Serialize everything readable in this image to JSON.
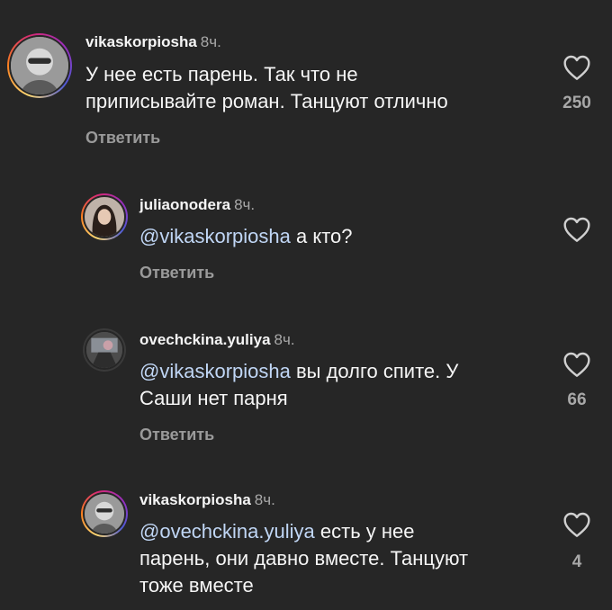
{
  "reply_label": "Ответить",
  "comments": [
    {
      "username": "vikaskorpiosha",
      "time": "8ч.",
      "mention": "",
      "line1": "У нее есть парень. Так что не",
      "line2": "приписывайте роман. Танцуют отлично",
      "line3": "",
      "likes": "250",
      "avatar_ring": true,
      "avatar_icon": "user-avatar-icon"
    },
    {
      "username": "juliaonodera",
      "time": "8ч.",
      "mention": "@vikaskorpiosha",
      "line1": " а кто?",
      "line2": "",
      "line3": "",
      "likes": "",
      "avatar_ring": true,
      "avatar_icon": "user-avatar-icon"
    },
    {
      "username": "ovechckina.yuliya",
      "time": "8ч.",
      "mention": "@vikaskorpiosha",
      "line1": " вы долго спите. У",
      "line2": "Саши нет парня",
      "line3": "",
      "likes": "66",
      "avatar_ring": false,
      "avatar_icon": "user-avatar-icon"
    },
    {
      "username": "vikaskorpiosha",
      "time": "8ч.",
      "mention": "@ovechckina.yuliya",
      "line1": " есть у нее",
      "line2": "парень, они давно вместе. Танцуют",
      "line3": "тоже вместе",
      "likes": "4",
      "avatar_ring": true,
      "avatar_icon": "user-avatar-icon"
    }
  ],
  "colors": {
    "background": "#262626",
    "text": "#f5f5f5",
    "secondary": "#a8a8a8",
    "mention": "#c0d6f5"
  }
}
